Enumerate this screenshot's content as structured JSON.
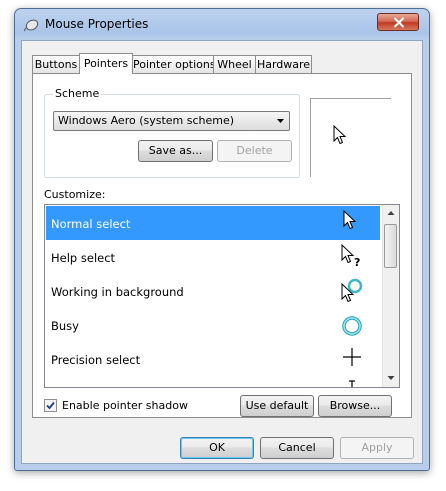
{
  "window": {
    "title": "Mouse Properties"
  },
  "tabs": [
    {
      "label": "Buttons"
    },
    {
      "label": "Pointers"
    },
    {
      "label": "Pointer options"
    },
    {
      "label": "Wheel"
    },
    {
      "label": "Hardware"
    }
  ],
  "scheme": {
    "label": "Scheme",
    "selected": "Windows Aero (system scheme)",
    "save_as_label": "Save as...",
    "delete_label": "Delete"
  },
  "customize": {
    "label": "Customize:",
    "items": [
      {
        "label": "Normal select",
        "icon": "arrow-cursor-icon"
      },
      {
        "label": "Help select",
        "icon": "help-cursor-icon"
      },
      {
        "label": "Working in background",
        "icon": "working-cursor-icon"
      },
      {
        "label": "Busy",
        "icon": "busy-cursor-icon"
      },
      {
        "label": "Precision select",
        "icon": "crosshair-cursor-icon"
      },
      {
        "label": "",
        "icon": "text-cursor-icon"
      }
    ]
  },
  "shadow": {
    "label": "Enable pointer shadow",
    "checked": true
  },
  "buttons": {
    "use_default": "Use default",
    "browse": "Browse...",
    "ok": "OK",
    "cancel": "Cancel",
    "apply": "Apply"
  },
  "colors": {
    "selection": "#3399ff",
    "title_bar": "#a9c4e8",
    "close": "#c03a22"
  }
}
